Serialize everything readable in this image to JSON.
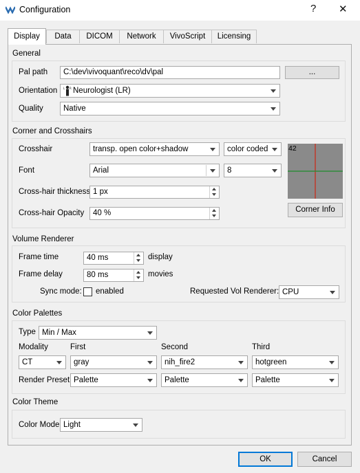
{
  "window": {
    "title": "Configuration",
    "help_glyph": "?",
    "close_glyph": "✕",
    "icon": "app-logo-icon"
  },
  "tabs": [
    {
      "label": "Display",
      "active": true
    },
    {
      "label": "Data",
      "active": false
    },
    {
      "label": "DICOM",
      "active": false
    },
    {
      "label": "Network",
      "active": false
    },
    {
      "label": "VivoScript",
      "active": false
    },
    {
      "label": "Licensing",
      "active": false
    }
  ],
  "general": {
    "title": "General",
    "pal_path_label": "Pal path",
    "pal_path_value": "C:\\dev\\vivoquant\\reco\\dv\\pal",
    "browse_label": "...",
    "orientation_label": "Orientation",
    "orientation_icon_text": "L R",
    "orientation_value": "Neurologist (LR)",
    "quality_label": "Quality",
    "quality_value": "Native"
  },
  "corner": {
    "title": "Corner and Crosshairs",
    "crosshair_label": "Crosshair",
    "crosshair_value": "transp. open color+shadow",
    "crosshair_color_value": "color coded",
    "font_label": "Font",
    "font_value": "Arial",
    "font_size_value": "8",
    "thickness_label": "Cross-hair thickness",
    "thickness_value": "1 px",
    "opacity_label": "Cross-hair Opacity",
    "opacity_value": "40 %",
    "preview_number": "42",
    "corner_info_label": "Corner Info",
    "preview_colors": {
      "background": "#8a8a8a",
      "vertical": "#c0392b",
      "horizontal": "#2e8b3a"
    }
  },
  "volume": {
    "title": "Volume Renderer",
    "frame_time_label": "Frame time",
    "frame_time_value": "40 ms",
    "frame_time_suffix": "display",
    "frame_delay_label": "Frame delay",
    "frame_delay_value": "80 ms",
    "frame_delay_suffix": "movies",
    "sync_label": "Sync mode:",
    "sync_checkbox_label": "enabled",
    "sync_checked": false,
    "requested_label": "Requested Vol Renderer:",
    "requested_value": "CPU"
  },
  "palettes": {
    "title": "Color Palettes",
    "type_label": "Type",
    "type_value": "Min / Max",
    "col_modality": "Modality",
    "col_first": "First",
    "col_second": "Second",
    "col_third": "Third",
    "modality_value": "CT",
    "first_value": "gray",
    "second_value": "nih_fire2",
    "third_value": "hotgreen",
    "render_preset_label": "Render Preset",
    "preset_first": "Palette",
    "preset_second": "Palette",
    "preset_third": "Palette"
  },
  "theme": {
    "title": "Color Theme",
    "mode_label": "Color Mode",
    "mode_value": "Light"
  },
  "footer": {
    "ok_label": "OK",
    "cancel_label": "Cancel"
  }
}
